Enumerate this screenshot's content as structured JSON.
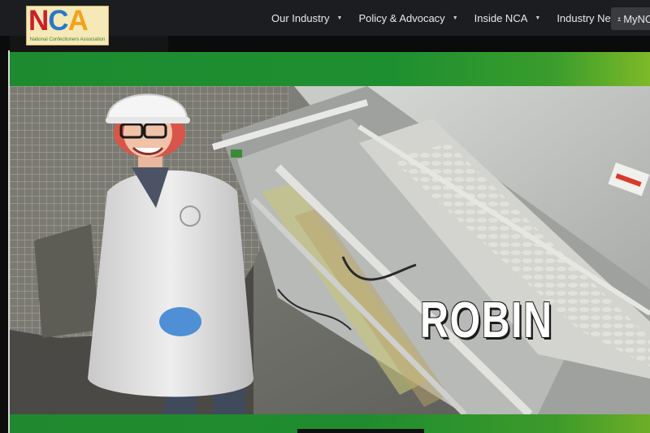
{
  "header": {
    "logo": {
      "letters": [
        {
          "char": "N",
          "color": "#c8202a"
        },
        {
          "char": "C",
          "color": "#2a78c8"
        },
        {
          "char": "A",
          "color": "#f2a21c"
        }
      ],
      "tagline": "National Confectioners Association"
    },
    "nav": [
      {
        "label": "Our Industry",
        "icon": "caret-down-icon"
      },
      {
        "label": "Policy & Advocacy",
        "icon": "caret-down-icon"
      },
      {
        "label": "Inside NCA",
        "icon": "caret-down-icon"
      },
      {
        "label": "Industry News",
        "icon": "caret-down-icon"
      }
    ],
    "my_button": {
      "label": "MyNCA",
      "icon": "user-icon"
    }
  },
  "hero": {
    "name": "ROBIN",
    "band_color": "#1e8f30"
  }
}
